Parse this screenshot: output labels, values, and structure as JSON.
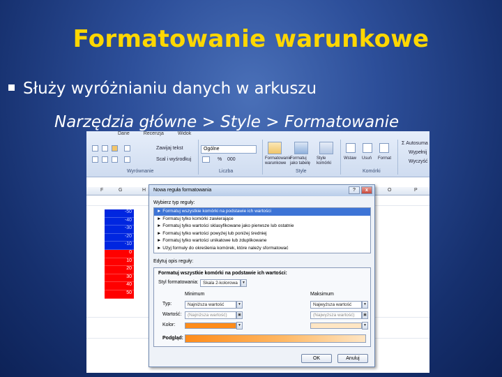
{
  "slide": {
    "title": "Formatowanie warunkowe",
    "bullet": "Służy wyróżnianiu danych w arkuszu",
    "path": "Narzędzia główne > Style > Formatowanie"
  },
  "ribbon": {
    "tabs": [
      "Dane",
      "Recenzja",
      "Widok"
    ],
    "wrap_text": "Zawijaj tekst",
    "merge": "Scal i wyśrodkuj",
    "number_format": "Ogólne",
    "groups": {
      "alignment": "Wyrównanie",
      "number": "Liczba",
      "styles": "Style",
      "cells": "Komórki"
    },
    "buttons": {
      "cond_format": "Formatowanie warunkowe",
      "format_table": "Formatuj jako tabelę",
      "cell_styles": "Style komórki",
      "insert": "Wstaw",
      "delete": "Usuń",
      "format": "Format",
      "autosum": "Autosuma",
      "fill": "Wypełnij",
      "clear": "Wyczyść"
    },
    "number_symbols": [
      "%",
      "000"
    ]
  },
  "sheet": {
    "columns": [
      "F",
      "G",
      "H",
      "O",
      "P"
    ],
    "values": [
      "-50",
      "-40",
      "-30",
      "-20",
      "-10",
      "0",
      "10",
      "20",
      "30",
      "40",
      "50"
    ]
  },
  "dialog": {
    "title": "Nowa reguła formatowania",
    "select_rule_type_label": "Wybierz typ reguły:",
    "rules": [
      "Formatuj wszystkie komórki na podstawie ich wartości",
      "Formatuj tylko komórki zawierające",
      "Formatuj tylko wartości sklasyfikowane jako pierwsze lub ostatnie",
      "Formatuj tylko wartości powyżej lub poniżej średniej",
      "Formatuj tylko wartości unikatowe lub zduplikowane",
      "Użyj formuły do określenia komórek, które należy sformatować"
    ],
    "edit_rule_label": "Edytuj opis reguły:",
    "panel_header": "Formatuj wszystkie komórki na podstawie ich wartości:",
    "format_style_label": "Styl formatowania:",
    "format_style_value": "Skala 2-kolorowa",
    "min_header": "Minimum",
    "max_header": "Maksimum",
    "type_label": "Typ:",
    "value_label": "Wartość:",
    "color_label": "Kolor:",
    "preview_label": "Podgląd:",
    "min_type": "Najniższa wartość",
    "max_type": "Najwyższa wartość",
    "min_value": "(Najniższa wartość)",
    "max_value": "(Najwyższa wartość)",
    "min_color": "#ff8c1a",
    "max_color": "#ffe6c4",
    "ok": "OK",
    "cancel": "Anuluj"
  }
}
